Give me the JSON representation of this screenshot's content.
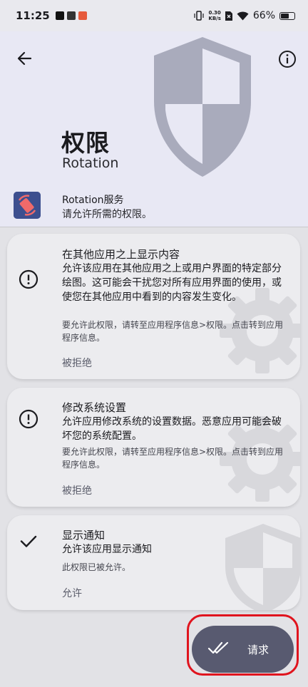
{
  "status_bar": {
    "time": "11:25",
    "net_speed_value": "0.30",
    "net_speed_unit": "KB/s",
    "battery": "66%",
    "battery_level": 0.66
  },
  "header": {
    "title": "权限",
    "subtitle": "Rotation"
  },
  "app": {
    "name": "Rotation服务",
    "description": "请允许所需的权限。"
  },
  "permissions": [
    {
      "title": "在其他应用之上显示内容",
      "description": "允许该应用在其他应用之上或用户界面的特定部分绘图。这可能会干扰您对所有应用界面的使用，或使您在其他应用中看到的内容发生变化。",
      "hint": "要允许此权限，请转至应用程序信息>权限。点击转到应用程序信息。",
      "status": "被拒绝",
      "icon": "error-outline-icon"
    },
    {
      "title": "修改系统设置",
      "description": "允许应用修改系统的设置数据。恶意应用可能会破坏您的系统配置。",
      "hint": "要允许此权限，请转至应用程序信息>权限。点击转到应用程序信息。",
      "status": "被拒绝",
      "icon": "error-outline-icon"
    },
    {
      "title": "显示通知",
      "description": "允许该应用显示通知",
      "hint": "此权限已被允许。",
      "status": "允许",
      "icon": "check-icon"
    }
  ],
  "fab": {
    "label": "请求",
    "icon": "done-all-icon"
  },
  "colors": {
    "header_bg": "#e8e8f4",
    "card_bg": "#ececef",
    "fab_bg": "#585a70",
    "highlight": "#e0141e",
    "app_icon_bg": "#3d4f8f",
    "app_icon_accent": "#f06a6a"
  }
}
